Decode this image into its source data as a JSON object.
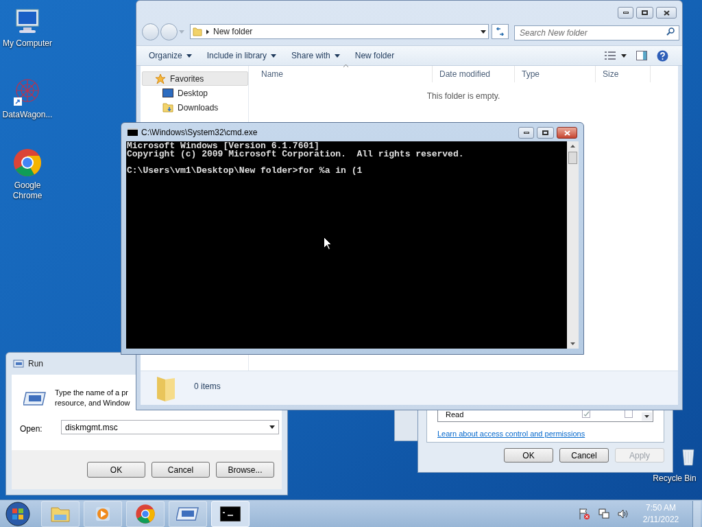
{
  "desktop_icons": [
    {
      "kind": "computer",
      "label": "My Computer"
    },
    {
      "kind": "datawagon",
      "label": "DataWagon..."
    },
    {
      "kind": "chrome",
      "label": "Google Chrome"
    },
    {
      "kind": "recycle",
      "label": "Recycle Bin"
    }
  ],
  "permissions_dialog": {
    "rows": [
      {
        "label": "Read",
        "allow": true,
        "deny": false
      }
    ],
    "link": "Learn about access control and permissions",
    "buttons": [
      {
        "label": "OK",
        "disabled": false
      },
      {
        "label": "Cancel",
        "disabled": false
      },
      {
        "label": "Apply",
        "disabled": true
      }
    ]
  },
  "run_dialog": {
    "title": "Run",
    "description": [
      "Type the name of a pr",
      "resource, and Window"
    ],
    "open_label": "Open:",
    "open_value": "diskmgmt.msc",
    "buttons": [
      "OK",
      "Cancel",
      "Browse..."
    ]
  },
  "explorer": {
    "address": "New folder",
    "search_placeholder": "Search New folder",
    "toolbar": [
      {
        "label": "Organize",
        "dropdown": true
      },
      {
        "label": "Include in library",
        "dropdown": true
      },
      {
        "label": "Share with",
        "dropdown": true
      },
      {
        "label": "New folder",
        "dropdown": false
      }
    ],
    "nav_items": [
      {
        "kind": "group",
        "label": "Favorites",
        "selected": true
      },
      {
        "kind": "desktop",
        "label": "Desktop",
        "selected": false
      },
      {
        "kind": "downloads",
        "label": "Downloads",
        "selected": false
      }
    ],
    "columns": [
      {
        "label": "Name",
        "sorted": true
      },
      {
        "label": "Date modified",
        "sorted": false
      },
      {
        "label": "Type",
        "sorted": false
      },
      {
        "label": "Size",
        "sorted": false
      }
    ],
    "empty_message": "This folder is empty.",
    "status": "0 items"
  },
  "cmd": {
    "title": "C:\\Windows\\System32\\cmd.exe",
    "output": [
      "Microsoft Windows [Version 6.1.7601]",
      "Copyright (c) 2009 Microsoft Corporation.  All rights reserved."
    ],
    "prompt_line": "C:\\Users\\vm1\\Desktop\\New folder>for %a in (1"
  },
  "taskbar": {
    "items": [
      {
        "kind": "explorer",
        "selected": false
      },
      {
        "kind": "media",
        "selected": false
      },
      {
        "kind": "chrome",
        "selected": false
      },
      {
        "kind": "run",
        "selected": false
      },
      {
        "kind": "cmd",
        "selected": true
      }
    ],
    "time": "7:50 AM",
    "date": "2/11/2022"
  }
}
